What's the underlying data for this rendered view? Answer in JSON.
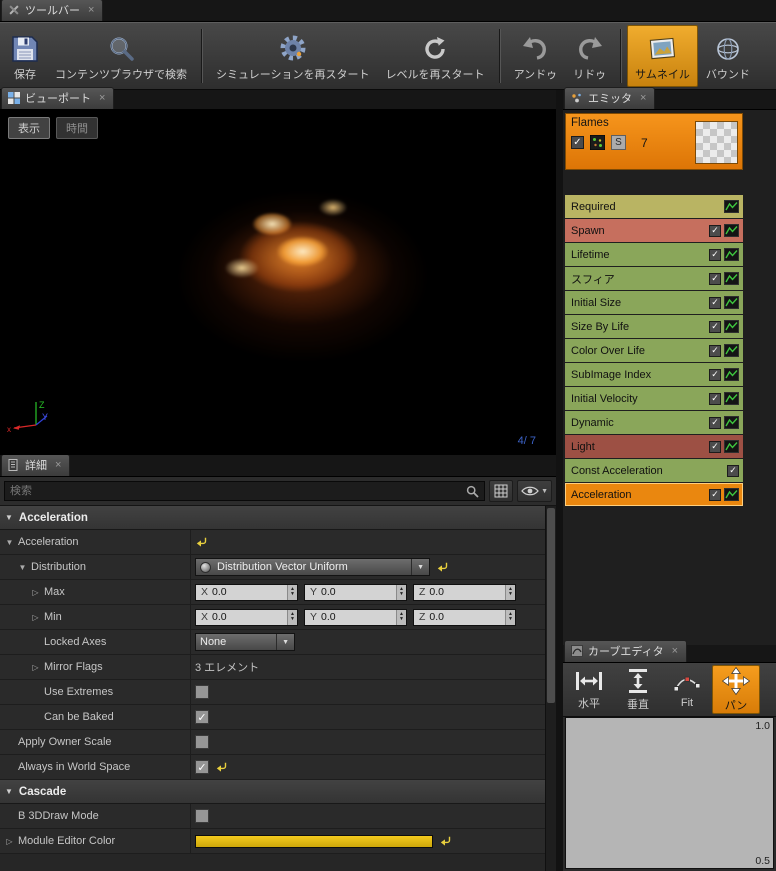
{
  "toolbar": {
    "tab": "ツールバー",
    "groups": [
      [
        {
          "label": "保存",
          "icon": "save-icon",
          "name": "save-button"
        },
        {
          "label": "コンテンツブラウザで検索",
          "icon": "search-icon",
          "name": "find-in-content-browser-button"
        }
      ],
      [
        {
          "label": "シミュレーションを再スタート",
          "icon": "gear-icon",
          "name": "restart-simulation-button"
        },
        {
          "label": "レベルを再スタート",
          "icon": "restart-icon",
          "name": "restart-level-button"
        }
      ],
      [
        {
          "label": "アンドゥ",
          "icon": "undo-icon",
          "name": "undo-button"
        },
        {
          "label": "リドゥ",
          "icon": "redo-icon",
          "name": "redo-button"
        }
      ],
      [
        {
          "label": "サムネイル",
          "icon": "thumbnail-icon",
          "name": "thumbnail-button",
          "active": true
        },
        {
          "label": "バウンド",
          "icon": "bounds-icon",
          "name": "bounds-button"
        }
      ]
    ]
  },
  "viewport": {
    "tab": "ビューポート",
    "display_button": "表示",
    "time_button": "時間",
    "counter": "4/ 7",
    "axis": {
      "x": "x",
      "y": "Y",
      "z": "Z"
    }
  },
  "emitters": {
    "tab": "エミッタ",
    "emitter": {
      "name": "Flames",
      "count": "7",
      "badge": "S"
    },
    "modules": [
      {
        "label": "Required",
        "color": "#b9b463",
        "checkbox": null,
        "graph": true,
        "selected": false
      },
      {
        "label": "Spawn",
        "color": "#c66f5e",
        "checkbox": true,
        "graph": true,
        "selected": false
      },
      {
        "label": "Lifetime",
        "color": "#8aa65a",
        "checkbox": true,
        "graph": true,
        "selected": false
      },
      {
        "label": "スフィア",
        "color": "#8aa65a",
        "checkbox": true,
        "graph": true,
        "selected": false
      },
      {
        "label": "Initial Size",
        "color": "#8aa65a",
        "checkbox": true,
        "graph": true,
        "selected": false
      },
      {
        "label": "Size By Life",
        "color": "#8aa65a",
        "checkbox": true,
        "graph": true,
        "selected": false
      },
      {
        "label": "Color Over Life",
        "color": "#8aa65a",
        "checkbox": true,
        "graph": true,
        "selected": false
      },
      {
        "label": "SubImage Index",
        "color": "#8aa65a",
        "checkbox": true,
        "graph": true,
        "selected": false
      },
      {
        "label": "Initial Velocity",
        "color": "#8aa65a",
        "checkbox": true,
        "graph": true,
        "selected": false
      },
      {
        "label": "Dynamic",
        "color": "#8aa65a",
        "checkbox": true,
        "graph": true,
        "selected": false
      },
      {
        "label": "Light",
        "color": "#9d5044",
        "checkbox": true,
        "graph": true,
        "selected": false
      },
      {
        "label": "Const Acceleration",
        "color": "#8aa65a",
        "checkbox": true,
        "graph": false,
        "selected": false
      },
      {
        "label": "Acceleration",
        "color": "#ea870f",
        "checkbox": true,
        "graph": true,
        "selected": true
      }
    ]
  },
  "details": {
    "tab": "詳細",
    "search_placeholder": "検索",
    "rows": [
      {
        "type": "category",
        "label": "Acceleration"
      },
      {
        "type": "prop",
        "label": "Acceleration",
        "indent": 1,
        "expand": "open",
        "value": "reset"
      },
      {
        "type": "prop",
        "label": "Distribution",
        "indent": 2,
        "expand": "open",
        "value": "dropdown",
        "value_text": "Distribution Vector Uniform",
        "reset": true
      },
      {
        "type": "prop",
        "label": "Max",
        "indent": 3,
        "expand": "closed",
        "value": "vector",
        "fields": [
          [
            "X",
            "0.0"
          ],
          [
            "Y",
            "0.0"
          ],
          [
            "Z",
            "0.0"
          ]
        ]
      },
      {
        "type": "prop",
        "label": "Min",
        "indent": 3,
        "expand": "closed",
        "value": "vector",
        "fields": [
          [
            "X",
            "0.0"
          ],
          [
            "Y",
            "0.0"
          ],
          [
            "Z",
            "0.0"
          ]
        ]
      },
      {
        "type": "prop",
        "label": "Locked Axes",
        "indent": 3,
        "value": "dropdown-small",
        "value_text": "None"
      },
      {
        "type": "prop",
        "label": "Mirror Flags",
        "indent": 3,
        "expand": "closed",
        "value": "text",
        "value_text": "3 エレメント"
      },
      {
        "type": "prop",
        "label": "Use Extremes",
        "indent": 3,
        "value": "checkbox",
        "checked": false
      },
      {
        "type": "prop",
        "label": "Can be Baked",
        "indent": 3,
        "value": "checkbox",
        "checked": true
      },
      {
        "type": "prop",
        "label": "Apply Owner Scale",
        "indent": 1,
        "value": "checkbox",
        "checked": false
      },
      {
        "type": "prop",
        "label": "Always in World Space",
        "indent": 1,
        "value": "checkbox",
        "checked": true,
        "reset": true
      },
      {
        "type": "category",
        "label": "Cascade"
      },
      {
        "type": "prop",
        "label": "B 3DDraw Mode",
        "indent": 1,
        "value": "checkbox",
        "checked": false
      },
      {
        "type": "prop",
        "label": "Module Editor Color",
        "indent": 1,
        "expand": "closed",
        "value": "colorbar",
        "color": "#cda70a",
        "reset": true
      }
    ]
  },
  "curve_editor": {
    "tab": "カーブエディタ",
    "buttons": [
      {
        "label": "水平",
        "icon": "horizontal-icon",
        "name": "fit-horizontal-button"
      },
      {
        "label": "垂直",
        "icon": "vertical-icon",
        "name": "fit-vertical-button"
      },
      {
        "label": "Fit",
        "icon": "fit-icon",
        "name": "fit-button"
      },
      {
        "label": "パン",
        "icon": "pan-icon",
        "name": "pan-button",
        "active": true
      }
    ],
    "y_labels": [
      "1.0",
      "0.5"
    ]
  },
  "colors": {
    "accent_orange": "#ea870f",
    "module_green": "#8aa65a",
    "module_red": "#c66f5e",
    "module_khaki": "#b9b463",
    "module_dark_red": "#9d5044",
    "editor_yellow": "#e8bc10"
  }
}
